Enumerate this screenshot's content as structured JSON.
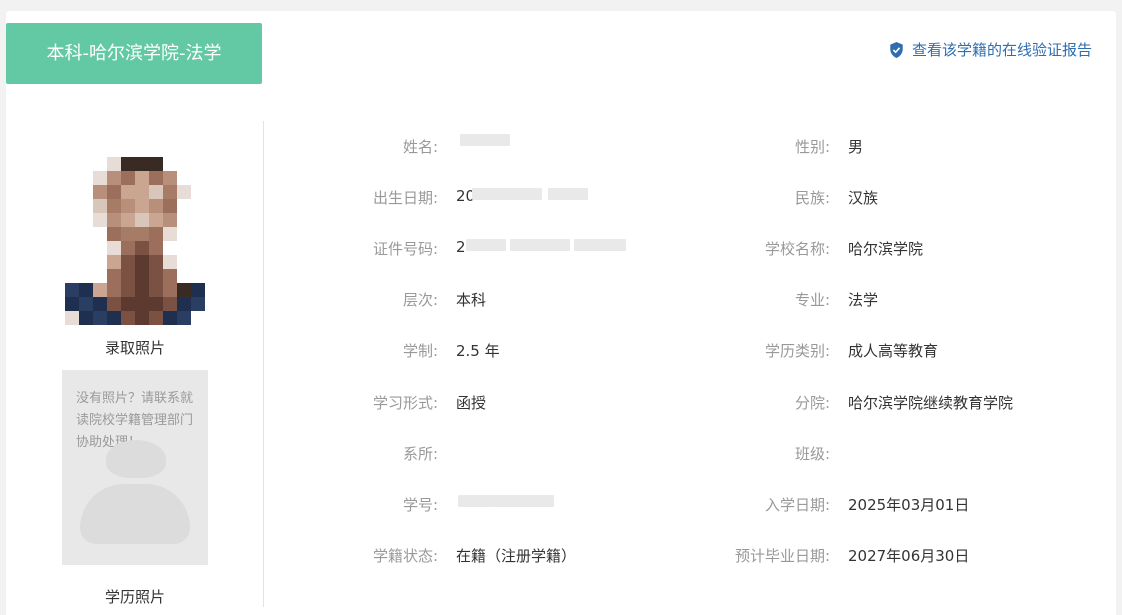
{
  "header": {
    "title": "本科-哈尔滨学院-法学",
    "verify_link": "查看该学籍的在线验证报告",
    "verify_icon": "shield-check-icon",
    "accent": "#63c9a5",
    "link_color": "#2f6db0"
  },
  "photos": {
    "admission_caption": "录取照片",
    "diploma_caption": "学历照片",
    "diploma_missing_note": "没有照片？请联系就读院校学籍管理部门协助处理！"
  },
  "fields_left": [
    {
      "label": "姓名:",
      "value": ""
    },
    {
      "label": "出生日期:",
      "value": "20"
    },
    {
      "label": "证件号码:",
      "value": "2"
    },
    {
      "label": "层次:",
      "value": "本科"
    },
    {
      "label": "学制:",
      "value": "2.5 年"
    },
    {
      "label": "学习形式:",
      "value": "函授"
    },
    {
      "label": "系所:",
      "value": ""
    },
    {
      "label": "学号:",
      "value": ""
    },
    {
      "label": "学籍状态:",
      "value": "在籍（注册学籍）"
    }
  ],
  "fields_right": [
    {
      "label": "性别:",
      "value": "男"
    },
    {
      "label": "民族:",
      "value": "汉族"
    },
    {
      "label": "学校名称:",
      "value": "哈尔滨学院"
    },
    {
      "label": "专业:",
      "value": "法学"
    },
    {
      "label": "学历类别:",
      "value": "成人高等教育"
    },
    {
      "label": "分院:",
      "value": "哈尔滨学院继续教育学院"
    },
    {
      "label": "班级:",
      "value": ""
    },
    {
      "label": "入学日期:",
      "value": "2025年03月01日"
    },
    {
      "label": "预计毕业日期:",
      "value": "2027年06月30日"
    }
  ]
}
